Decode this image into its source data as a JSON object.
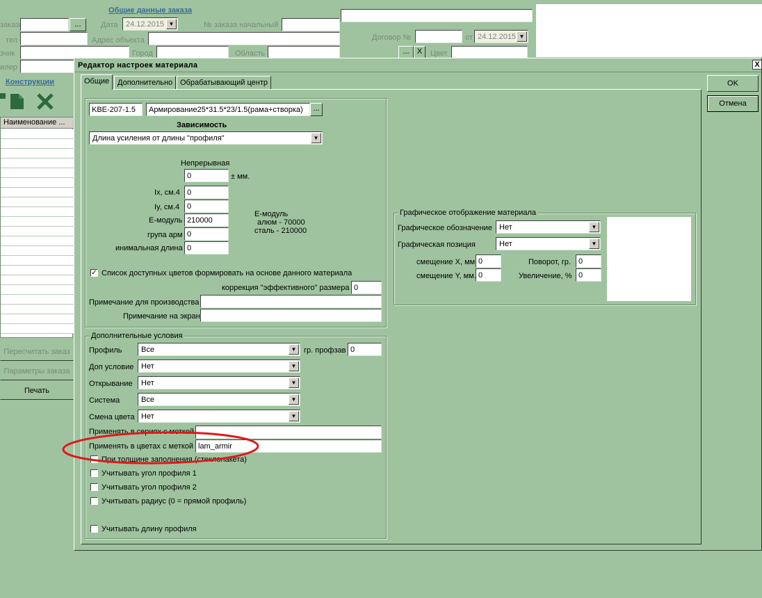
{
  "bg_form": {
    "section_title": "Общие данные заказа",
    "label_zakaza": "заказа",
    "label_data": "Дата",
    "date_value": "24.12.2015",
    "browse_btn": "...",
    "label_order_start": "№ заказа начальный",
    "label_tel": "тел",
    "label_address": "Адрес объекта",
    "label_dogovor": "Договор №",
    "label_ot": "от",
    "dogovor_date": "24.12.2015",
    "label_zakazchik": "зчик",
    "label_gorod": "Город",
    "label_oblast": "Область",
    "label_color": "Цвет",
    "x_btn": "X",
    "label_diler": "илер",
    "konstrukcii": "Конструкции",
    "grid_header": "Наименование ...",
    "btn_recalc": "Пересчитать заказ",
    "btn_params": "Параметры заказа",
    "btn_print": "Печать"
  },
  "dialog": {
    "title": "Редактор настроек материала",
    "close": "X",
    "ok": "OK",
    "cancel": "Отмена",
    "tabs": [
      "Общие",
      "Дополнительно",
      "Обрабатывающий центр"
    ],
    "article": "KBE-207-1.5",
    "material_name": "Армирование25*31.5*23/1.5(рама+створка)",
    "material_browse": "...",
    "dependency_title": "Зависимость",
    "dependency_value": "Длина усиления от длины \"профиля\"",
    "continuous_label": "Непрерывная",
    "continuous_value": "0",
    "pm_mm": "± мм.",
    "ix_label": "Ix, см.4",
    "ix_value": "0",
    "iy_label": "Iy, см.4",
    "iy_value": "0",
    "emod_label": "Е-модуль",
    "emod_value": "210000",
    "emod_note1": "Е-модуль",
    "emod_note2": "алюм - 70000",
    "emod_note3": "сталь - 210000",
    "group_label": "група арм",
    "group_value": "0",
    "minlen_label": "инимальная длина",
    "minlen_value": "0",
    "colors_checkbox": "Список доступных цветов формировать на основе данного материала",
    "correction_label": "коррекция \"эффективного\" размера",
    "correction_value": "0",
    "note_prod_label": "Примечание для производства",
    "note_prod_value": "",
    "note_screen_label": "Примечание на экран",
    "note_screen_value": "",
    "graph_group": "Графическое отображение материала",
    "graph_sym_label": "Графическое обозначение",
    "graph_sym_value": "Нет",
    "graph_pos_label": "Графическая позиция",
    "graph_pos_value": "Нет",
    "shift_x_label": "смещение X, мм.",
    "shift_x_value": "0",
    "rotate_label": "Поворот, гр.",
    "rotate_value": "0",
    "shift_y_label": "смещение Y, мм.",
    "shift_y_value": "0",
    "scale_label": "Увеличение, %",
    "scale_value": "0",
    "extra_group": "Дополнительные условия",
    "profile_label": "Профиль",
    "profile_value": "Все",
    "profgroup_label": "гр. профзав",
    "profgroup_value": "0",
    "addcond_label": "Доп условие",
    "addcond_value": "Нет",
    "opening_label": "Открывание",
    "opening_value": "Нет",
    "system_label": "Система",
    "system_value": "Все",
    "colorchange_label": "Смена цвета",
    "colorchange_value": "Нет",
    "series_label": "Применять в сериях с меткой",
    "series_value": "",
    "colors_label": "Применять в цветах с меткой",
    "colors_value": "lam_armir",
    "cb_thickness": "При толщине заполнения (стеклопакета)",
    "cb_angle1": "Учитывать угол профиля 1",
    "cb_angle2": "Учитывать угол профиля 2",
    "cb_radius": "Учитывать радиус (0 = прямой профиль)",
    "cb_length": "Учитывать длину профиля"
  },
  "colors": {
    "background": "#9fc39f",
    "titlebar": "#9fc39f",
    "annotation": "#e0181c"
  }
}
